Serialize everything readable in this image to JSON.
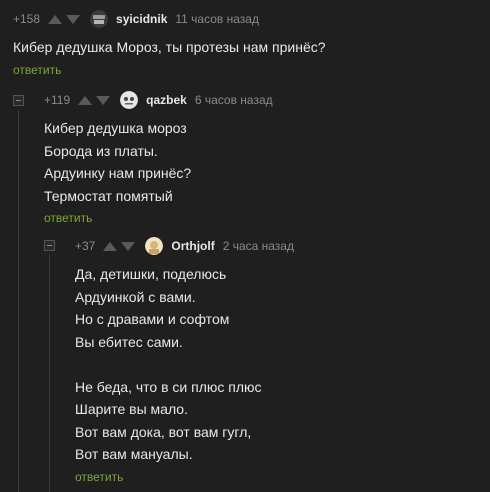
{
  "comments": [
    {
      "rating": "+158",
      "author": "syicidnik",
      "time": "11 часов назад",
      "lines": [
        "Кибер дедушка Мороз, ты протезы нам принёс?"
      ],
      "reply": "ответить",
      "avatar_color": "#9a9a9a"
    },
    {
      "rating": "+119",
      "author": "qazbek",
      "time": "6 часов назад",
      "lines": [
        "Кибер дедушка мороз",
        "Борода из платы.",
        "Ардуинку нам принёс?",
        "Термостат помятый"
      ],
      "reply": "ответить",
      "avatar_color": "#d8d8d8"
    },
    {
      "rating": "+37",
      "author": "Orthjolf",
      "time": "2 часа назад",
      "lines": [
        "Да, детишки, поделюсь",
        "Ардуинкой с вами.",
        "Но с дравами и софтом",
        "Вы ебитес сами.",
        "",
        "Не беда, что в си плюс плюс",
        "Шарите вы мало.",
        "Вот вам дока, вот вам гугл,",
        "Вот вам мануалы."
      ],
      "reply": "ответить",
      "avatar_color": "#e8d6a8"
    }
  ],
  "accent_color": "#7fa63a"
}
